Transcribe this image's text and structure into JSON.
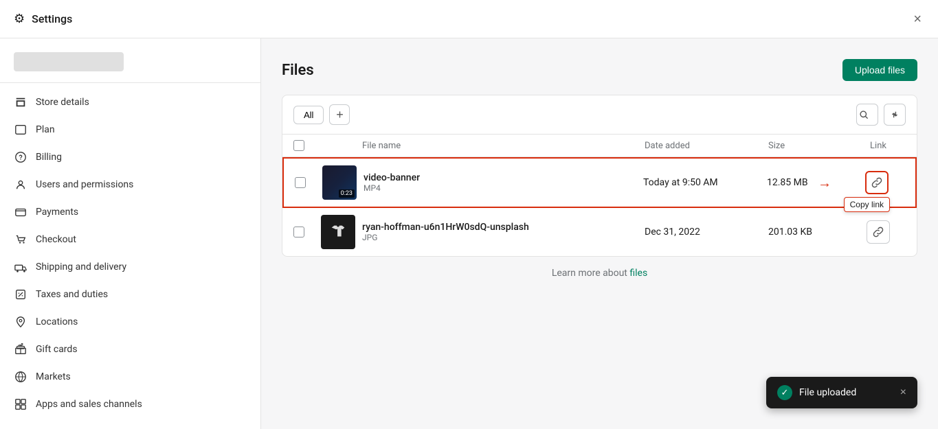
{
  "header": {
    "title": "Settings",
    "close_label": "×"
  },
  "sidebar": {
    "logo_alt": "Store logo",
    "nav_items": [
      {
        "id": "store-details",
        "label": "Store details",
        "icon": "store"
      },
      {
        "id": "plan",
        "label": "Plan",
        "icon": "plan"
      },
      {
        "id": "billing",
        "label": "Billing",
        "icon": "billing"
      },
      {
        "id": "users-permissions",
        "label": "Users and permissions",
        "icon": "user"
      },
      {
        "id": "payments",
        "label": "Payments",
        "icon": "payments"
      },
      {
        "id": "checkout",
        "label": "Checkout",
        "icon": "checkout"
      },
      {
        "id": "shipping-delivery",
        "label": "Shipping and delivery",
        "icon": "shipping"
      },
      {
        "id": "taxes-duties",
        "label": "Taxes and duties",
        "icon": "taxes"
      },
      {
        "id": "locations",
        "label": "Locations",
        "icon": "location"
      },
      {
        "id": "gift-cards",
        "label": "Gift cards",
        "icon": "gift"
      },
      {
        "id": "markets",
        "label": "Markets",
        "icon": "markets"
      },
      {
        "id": "apps-sales-channels",
        "label": "Apps and sales channels",
        "icon": "apps"
      }
    ]
  },
  "content": {
    "page_title": "Files",
    "upload_button_label": "Upload files",
    "toolbar": {
      "tab_all": "All",
      "add_label": "+",
      "search_icon": "search",
      "filter_icon": "filter",
      "sort_icon": "sort"
    },
    "table": {
      "columns": [
        "",
        "",
        "File name",
        "Date added",
        "Size",
        "Link"
      ],
      "rows": [
        {
          "id": "video-banner",
          "name": "video-banner",
          "type": "MP4",
          "date_added": "Today at 9:50 AM",
          "size": "12.85 MB",
          "duration": "0:23",
          "thumb_type": "video",
          "highlighted": true
        },
        {
          "id": "ryan-hoffman",
          "name": "ryan-hoffman-u6n1HrW0sdQ-unsplash",
          "type": "JPG",
          "date_added": "Dec 31, 2022",
          "size": "201.03 KB",
          "thumb_type": "image",
          "highlighted": false
        }
      ]
    },
    "learn_more_text": "Learn more about ",
    "learn_more_link_text": "files",
    "learn_more_link_href": "#"
  },
  "toast": {
    "message": "File uploaded",
    "close_label": "×",
    "icon": "✓"
  },
  "copy_tooltip": "Copy link",
  "arrow": "→"
}
